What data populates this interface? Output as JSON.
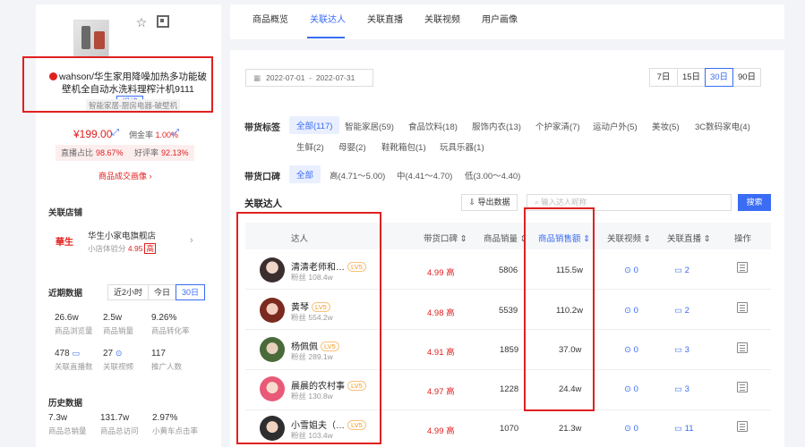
{
  "product": {
    "title": "wahson/华生家用降噪加热多功能破壁机全自动水洗料理榨汁机9111",
    "spec_label": "规格",
    "category": "智能家居-厨房电器-破壁机",
    "price": "¥199.00",
    "commission_label": "佣金率",
    "commission_value": "1.00%",
    "live_ratio_label": "直播占比",
    "live_ratio_value": "98.67%",
    "good_rate_label": "好评率",
    "good_rate_value": "92.13%",
    "trade_link": "商品成交画像 ›"
  },
  "store": {
    "section": "关联店铺",
    "logo_text": "華生",
    "name": "华生小家电旗舰店",
    "score_label": "小店体验分",
    "score_value": "4.95",
    "score_badge": "高"
  },
  "recent": {
    "section": "近期数据",
    "periods": [
      "近2小时",
      "今日",
      "30日"
    ],
    "metrics": [
      {
        "value": "26.6w",
        "label": "商品浏览量"
      },
      {
        "value": "2.5w",
        "label": "商品销量"
      },
      {
        "value": "9.26%",
        "label": "商品转化率"
      },
      {
        "value": "478",
        "label": "关联直播数"
      },
      {
        "value": "27",
        "label": "关联视频"
      },
      {
        "value": "117",
        "label": "推广人数"
      }
    ]
  },
  "history": {
    "section": "历史数据",
    "metrics": [
      {
        "value": "7.3w",
        "label": "商品总销量"
      },
      {
        "value": "131.7w",
        "label": "商品总访问"
      },
      {
        "value": "2.97%",
        "label": "小黄车点击率"
      }
    ]
  },
  "tabs": [
    "商品概览",
    "关联达人",
    "关联直播",
    "关联视频",
    "用户画像"
  ],
  "date_range": {
    "start": "2022-07-01",
    "sep": "-",
    "end": "2022-07-31"
  },
  "periods": [
    "7日",
    "15日",
    "30日",
    "90日"
  ],
  "filters": {
    "tag_label": "带货标签",
    "tags": [
      "全部(117)",
      "智能家居(59)",
      "食品饮料(18)",
      "服饰内衣(13)",
      "个护家清(7)",
      "运动户外(5)",
      "美妆(5)",
      "3C数码家电(4)",
      "生鲜(2)",
      "母婴(2)",
      "鞋靴箱包(1)",
      "玩具乐器(1)"
    ],
    "rating_label": "带货口碑",
    "ratings": [
      "全部",
      "高(4.71～5.00)",
      "中(4.41～4.70)",
      "低(3.00～4.40)"
    ]
  },
  "list": {
    "title": "关联达人",
    "export_label": "导出数据",
    "search_placeholder": "输入达人昵称",
    "search_button": "搜索",
    "headers": [
      "达人",
      "带货口碑 ⇕",
      "商品销量 ⇕",
      "商品销售额 ⇕",
      "关联视频 ⇕",
      "关联直播 ⇕",
      "操作"
    ],
    "rows": [
      {
        "name": "清清老师和…",
        "lv": "LV5",
        "fans": "粉丝  108.4w",
        "rating": "4.99 高",
        "sales": "5806",
        "revenue": "115.5w",
        "videos": "0",
        "lives": "2"
      },
      {
        "name": "黄琴",
        "lv": "LV5",
        "fans": "粉丝  554.2w",
        "rating": "4.98 高",
        "sales": "5539",
        "revenue": "110.2w",
        "videos": "0",
        "lives": "2"
      },
      {
        "name": "杨佩佩",
        "lv": "LV5",
        "fans": "粉丝  289.1w",
        "rating": "4.91 高",
        "sales": "1859",
        "revenue": "37.0w",
        "videos": "0",
        "lives": "3"
      },
      {
        "name": "晨晨的农村事",
        "lv": "LV5",
        "fans": "粉丝  130.8w",
        "rating": "4.97 高",
        "sales": "1228",
        "revenue": "24.4w",
        "videos": "0",
        "lives": "3"
      },
      {
        "name": "小雪姐夫（…",
        "lv": "LV5",
        "fans": "粉丝  103.4w",
        "rating": "4.99 高",
        "sales": "1070",
        "revenue": "21.3w",
        "videos": "0",
        "lives": "11"
      }
    ]
  },
  "colors": {
    "accent": "#3a6cf4",
    "red": "#e02020"
  }
}
